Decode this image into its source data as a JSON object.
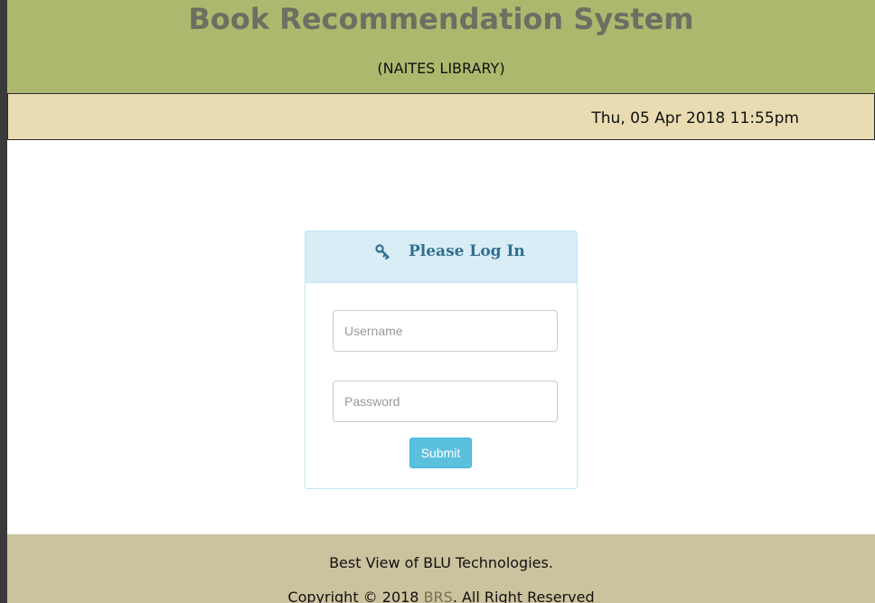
{
  "header": {
    "title": "Book Recommendation System",
    "subtitle": "(NAITES LIBRARY)"
  },
  "datebar": {
    "datetime": "Thu, 05 Apr 2018 11:55pm"
  },
  "login": {
    "heading_icon": "key-icon",
    "heading": "Please Log In",
    "username_placeholder": "Username",
    "password_placeholder": "Password",
    "submit_label": "Submit"
  },
  "footer": {
    "line1": "Best View of BLU Technologies.",
    "copyright_prefix": "Copyright © 2018 ",
    "brand_link": "BRS",
    "copyright_suffix": ". All Right Reserved"
  },
  "colors": {
    "header_bg": "#adb86e",
    "datebar_bg": "#e9dcb2",
    "panel_heading_bg": "#d9edf7",
    "panel_heading_text": "#31708f",
    "submit_bg": "#5bc0de",
    "footer_bg": "#cbc39e"
  }
}
